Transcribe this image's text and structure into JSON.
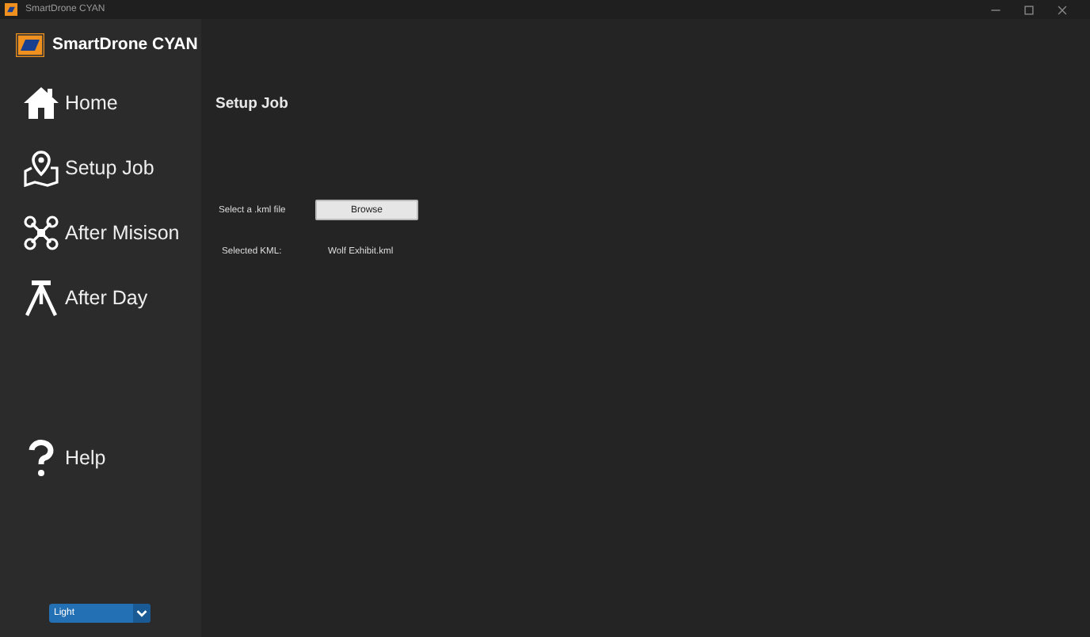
{
  "window": {
    "title": "SmartDrone CYAN"
  },
  "sidebar": {
    "app_name": "SmartDrone CYAN",
    "items": [
      {
        "label": "Home"
      },
      {
        "label": "Setup Job"
      },
      {
        "label": "After Misison"
      },
      {
        "label": "After Day"
      }
    ],
    "help": {
      "label": "Help"
    },
    "theme_select": {
      "value": "Light"
    }
  },
  "main": {
    "heading": "Setup Job",
    "file_label": "Select a .kml file",
    "browse_button": "Browse",
    "selected_label": "Selected KML:",
    "selected_value": "Wolf Exhibit.kml"
  }
}
